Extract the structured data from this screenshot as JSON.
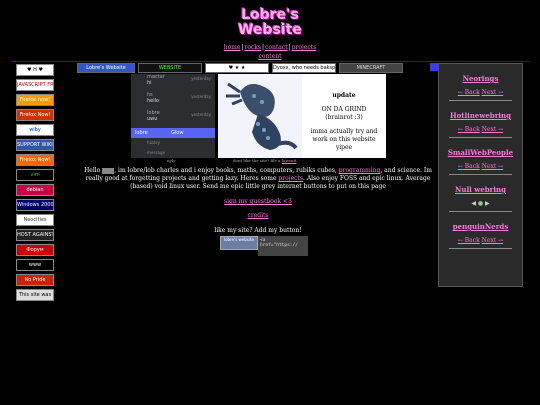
{
  "site": {
    "logo_line1": "Lobre's",
    "logo_line2": "Website",
    "nav": [
      "home",
      "rocks",
      "contact",
      "projects",
      "content"
    ]
  },
  "left_badges": [
    {
      "label": "♥ H ♥",
      "bg": "#ffffff",
      "fg": "#000000"
    },
    {
      "label": "JAVASCRIPT FREE",
      "bg": "#ffffff",
      "fg": "#cc0000"
    },
    {
      "label": "Firefox now!",
      "bg": "#ff9900",
      "fg": "#ffffff"
    },
    {
      "label": "Firefox Now!",
      "bg": "#cc3300",
      "fg": "#ffffff"
    },
    {
      "label": "wiby",
      "bg": "#ffffff",
      "fg": "#0033cc"
    },
    {
      "label": "SUPPORT WIKIPEDIA",
      "bg": "#3355aa",
      "fg": "#ffffff"
    },
    {
      "label": "Firefox Now!",
      "bg": "#ff6600",
      "fg": "#ffffff"
    },
    {
      "label": "vim",
      "bg": "#000000",
      "fg": "#33cc33"
    },
    {
      "label": "debian",
      "bg": "#cc0044",
      "fg": "#ffffff"
    },
    {
      "label": "Windows 2000",
      "bg": "#000066",
      "fg": "#ffffff"
    },
    {
      "label": "Neocities",
      "bg": "#ffffff",
      "fg": "#333333"
    },
    {
      "label": "HOST AGAINST MONOPOLIES",
      "bg": "#222222",
      "fg": "#ffffff"
    },
    {
      "label": "Форум",
      "bg": "#cc0000",
      "fg": "#ffffff"
    },
    {
      "label": "www",
      "bg": "#000000",
      "fg": "#ffffff"
    },
    {
      "label": "No Pride",
      "bg": "#cc2200",
      "fg": "#ffffff"
    },
    {
      "label": "This site was",
      "bg": "#dddddd",
      "fg": "#000000"
    }
  ],
  "banner_strip": [
    {
      "label": "Lobre's Website",
      "bg": "#3355cc",
      "fg": "#ffffff",
      "w": 56
    },
    {
      "label": "WEBSITE",
      "bg": "#111111",
      "fg": "#33ff33",
      "w": 62
    },
    {
      "label": "♥ ★ ★",
      "bg": "#ffffff",
      "fg": "#000000",
      "w": 62
    },
    {
      "label": "Dyoxx, who needs bakspace",
      "bg": "#ffffff",
      "fg": "#000000",
      "w": 62
    },
    {
      "label": "MINECRAFT",
      "bg": "#444444",
      "fg": "#dddddd",
      "w": 62
    }
  ],
  "discord": {
    "messages": [
      {
        "name": "mactar",
        "text": "hi",
        "time": "yesterday"
      },
      {
        "name": "hs",
        "text": "hello",
        "time": "yesterday"
      },
      {
        "name": "lobre",
        "text": "uwu",
        "time": "yesterday"
      }
    ],
    "status_left": "lobre",
    "status_right": "Glow",
    "footer1": "fuzzey",
    "footer2": "message"
  },
  "captions": {
    "left": "nyly",
    "mid": "dont like the site? file a",
    "mid_link": "lawsuit"
  },
  "update": {
    "title": "update",
    "line1": "ON DA GRIND",
    "line2": "(brainrot :3)",
    "line3": "imma actually try and",
    "line4": "work on this website",
    "line5": "yipee"
  },
  "intro": {
    "hello": "Hello",
    "text1": ", im lobre/lob charles and i enjoy books, maths, computers, rubiks cubes,",
    "link1": "programming",
    "text2": ", and science. Im really good at forgetting projects and getting lazy. Heres some",
    "link2": "projects",
    "text3": ". Also enjoy FOSS and epic linux. Average (based) void linux user. Send me epic little grey internet buttons to put on this page"
  },
  "links": {
    "guestbook": "sign my guestbook <3",
    "credits": "credits",
    "add_button": "like my site? Add my button!"
  },
  "my_button": {
    "label": "lobre's website"
  },
  "code_snippet": "<a href=\"https://",
  "webrings": [
    {
      "title": "Neorings",
      "back": "← Back",
      "next": "Next →"
    },
    {
      "title": "Hotlinewebring",
      "back": "← Back",
      "next": "Next →"
    },
    {
      "title": "SmallWebPeople",
      "back": "← Back",
      "next": "Next →"
    },
    {
      "title": "Null webring",
      "back": "",
      "next": ""
    },
    {
      "title": "penguinNerds",
      "back": "← Back",
      "next": "Next →"
    }
  ],
  "colors": {
    "accent": "#ff7ad9",
    "background": "#000000"
  }
}
